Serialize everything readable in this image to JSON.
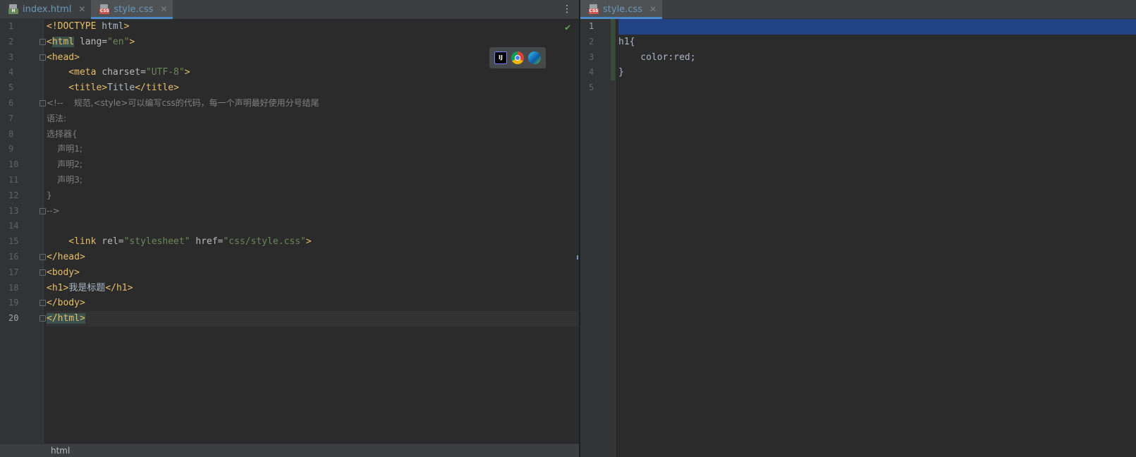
{
  "left_tabs": [
    {
      "label": "index.html",
      "badge": "H",
      "badge_color": "#6a8759"
    },
    {
      "label": "style.css",
      "badge": "CSS",
      "badge_color": "#c75450"
    }
  ],
  "right_tabs": [
    {
      "label": "style.css",
      "badge": "CSS",
      "badge_color": "#c75450"
    }
  ],
  "left_line_numbers": [
    "1",
    "2",
    "3",
    "4",
    "5",
    "6",
    "7",
    "8",
    "9",
    "10",
    "11",
    "12",
    "13",
    "14",
    "15",
    "16",
    "17",
    "18",
    "19",
    "20"
  ],
  "right_line_numbers": [
    "1",
    "2",
    "3",
    "4",
    "5"
  ],
  "html_code": {
    "l1_tag": "<!DOCTYPE",
    "l1_txt": " html",
    "l1_end": ">",
    "l2_tag_open": "<",
    "l2_tag_name": "html",
    "l2_attr": " lang=",
    "l2_str": "\"en\"",
    "l2_end": ">",
    "l3": "<head>",
    "l4_tag": "    <meta",
    "l4_attr": " charset=",
    "l4_str": "\"UTF-8\"",
    "l4_end": ">",
    "l5_tag1": "    <title>",
    "l5_txt": "Title",
    "l5_tag2": "</title>",
    "l6": "<!--    规范,<style>可以编写css的代码，每一个声明最好使用分号结尾",
    "l7": "语法:",
    "l8": "选择器{",
    "l9": "    声明1;",
    "l10": "    声明2;",
    "l11": "    声明3;",
    "l12": "}",
    "l13": "-->",
    "l15_tag": "    <link",
    "l15_attr1": " rel=",
    "l15_str1": "\"stylesheet\"",
    "l15_attr2": " href=",
    "l15_str2": "\"css/style.css\"",
    "l15_end": ">",
    "l16": "</head>",
    "l17": "<body>",
    "l18_tag1": "<h1>",
    "l18_txt": "我是标题",
    "l18_tag2": "</h1>",
    "l19": "</body>",
    "l20": "</html>"
  },
  "css_code": {
    "l2": "h1{",
    "l3": "    color:red;",
    "l4": "}"
  },
  "browser_popup": [
    "intellij-icon",
    "chrome-icon",
    "edge-icon"
  ],
  "status": {
    "breadcrumb": "html"
  },
  "colors": {
    "accent": "#4a88c7",
    "tag": "#e8bf6a",
    "string": "#6a8759",
    "comment": "#808080",
    "selection": "#214283"
  }
}
